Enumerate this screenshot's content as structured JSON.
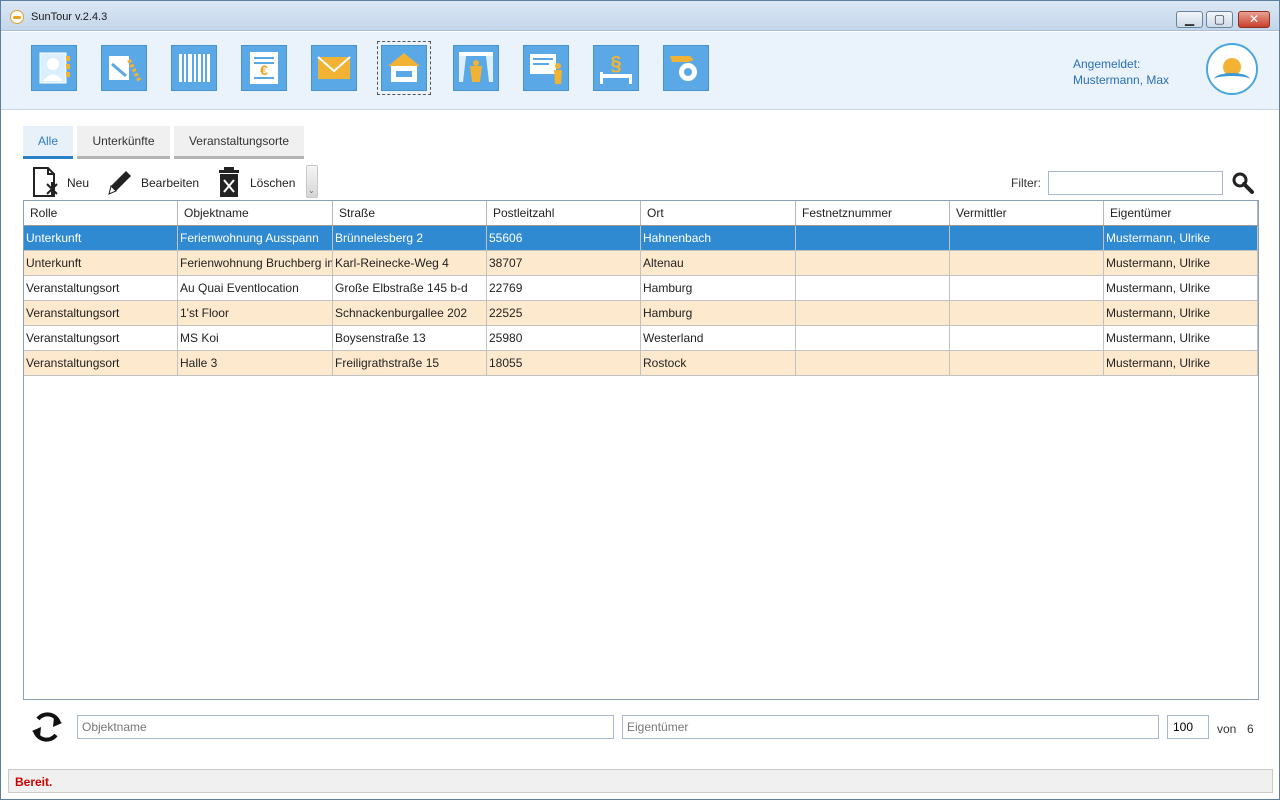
{
  "window": {
    "title": "SunTour v.2.4.3",
    "minimize_glyph": "▁",
    "maximize_glyph": "▢",
    "close_glyph": "✕"
  },
  "ribbon": {
    "icons": [
      {
        "name": "contacts-icon"
      },
      {
        "name": "travel-icon"
      },
      {
        "name": "barcode-icon"
      },
      {
        "name": "invoice-euro-icon"
      },
      {
        "name": "mail-icon"
      },
      {
        "name": "accommodation-icon",
        "active": true
      },
      {
        "name": "events-icon"
      },
      {
        "name": "presentation-icon"
      },
      {
        "name": "legal-icon"
      },
      {
        "name": "settings-tools-icon"
      }
    ],
    "login_label": "Angemeldet:",
    "login_user": "Mustermann, Max"
  },
  "tabs": [
    {
      "label": "Alle",
      "active": true
    },
    {
      "label": "Unterkünfte",
      "active": false
    },
    {
      "label": "Veranstaltungsorte",
      "active": false
    }
  ],
  "toolbar": {
    "new_label": "Neu",
    "edit_label": "Bearbeiten",
    "delete_label": "Löschen",
    "overflow_glyph": "⌄"
  },
  "filter": {
    "label": "Filter:",
    "value": ""
  },
  "grid": {
    "columns": [
      "Rolle",
      "Objektname",
      "Straße",
      "Postleitzahl",
      "Ort",
      "Festnetznummer",
      "Vermittler",
      "Eigentümer"
    ],
    "rows": [
      [
        "Unterkunft",
        "Ferienwohnung Ausspann",
        "Brünnelesberg 2",
        "55606",
        "Hahnenbach",
        "",
        "",
        "Mustermann, Ulrike"
      ],
      [
        "Unterkunft",
        "Ferienwohnung Bruchberg im Harz",
        "Karl-Reinecke-Weg 4",
        "38707",
        "Altenau",
        "",
        "",
        "Mustermann, Ulrike"
      ],
      [
        "Veranstaltungsort",
        "Au Quai Eventlocation",
        "Große Elbstraße 145 b-d",
        "22769",
        "Hamburg",
        "",
        "",
        "Mustermann, Ulrike"
      ],
      [
        "Veranstaltungsort",
        "1'st Floor",
        "Schnackenburgallee 202",
        "22525",
        "Hamburg",
        "",
        "",
        "Mustermann, Ulrike"
      ],
      [
        "Veranstaltungsort",
        "MS Koi",
        "Boysenstraße 13",
        "25980",
        "Westerland",
        "",
        "",
        "Mustermann, Ulrike"
      ],
      [
        "Veranstaltungsort",
        "Halle 3",
        "Freiligrathstraße 15",
        "18055",
        "Rostock",
        "",
        "",
        "Mustermann, Ulrike"
      ]
    ],
    "selected_row": 0
  },
  "bottom": {
    "objektname_placeholder": "Objektname",
    "eigentuemer_placeholder": "Eigentümer",
    "page_size": "100",
    "von_label": "von",
    "total": "6"
  },
  "status": {
    "text": "Bereit."
  },
  "colors": {
    "accent": "#2b7fc4",
    "selected_row": "#2f8ad2",
    "alt_row": "#fde9cd",
    "ribbon_icon": "#5aa9e6",
    "status_text": "#d10000"
  }
}
